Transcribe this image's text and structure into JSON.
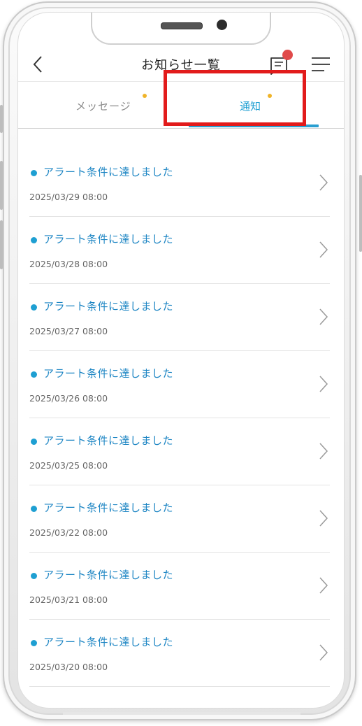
{
  "header": {
    "title": "お知らせ一覧",
    "back_icon": "chevron-left-icon",
    "message_icon": "message-icon",
    "menu_icon": "hamburger-menu-icon"
  },
  "tabs": [
    {
      "label": "メッセージ",
      "active": false,
      "has_dot": true
    },
    {
      "label": "通知",
      "active": true,
      "has_dot": true
    }
  ],
  "notifications": [
    {
      "title": "アラート条件に達しました",
      "date": "2025/03/29 08:00"
    },
    {
      "title": "アラート条件に達しました",
      "date": "2025/03/28 08:00"
    },
    {
      "title": "アラート条件に達しました",
      "date": "2025/03/27 08:00"
    },
    {
      "title": "アラート条件に達しました",
      "date": "2025/03/26 08:00"
    },
    {
      "title": "アラート条件に達しました",
      "date": "2025/03/25 08:00"
    },
    {
      "title": "アラート条件に達しました",
      "date": "2025/03/22 08:00"
    },
    {
      "title": "アラート条件に達しました",
      "date": "2025/03/21 08:00"
    },
    {
      "title": "アラート条件に達しました",
      "date": "2025/03/20 08:00"
    }
  ],
  "colors": {
    "accent": "#1e9fd2",
    "tab_dot": "#f0b429",
    "badge": "#e04a4a",
    "highlight": "#e21b1b"
  }
}
